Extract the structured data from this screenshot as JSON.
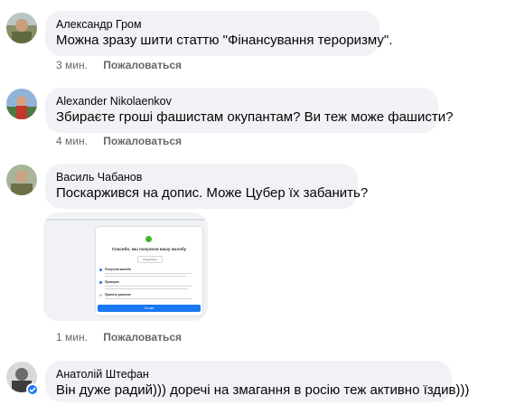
{
  "comments": [
    {
      "author": "Александр Гром",
      "text": "Можна зразу шити статтю \"Фінансування тероризму\".",
      "time": "3 мин.",
      "report": "Пожаловаться"
    },
    {
      "author": "Alexander Nikolaenkov",
      "text": "Збираєте гроші фашистам окупантам? Ви теж може фашисти?",
      "time": "4 мин.",
      "report": "Пожаловаться"
    },
    {
      "author": "Василь Чабанов",
      "text": "Поскаржився на допис. Може Цубер їх забанить?",
      "time": "1 мин.",
      "report": "Пожаловаться",
      "attachment": {
        "title": "Спасибо, мы получили вашу жалобу",
        "button": "Подробнее",
        "options": [
          "Получена жалоба",
          "Проверка",
          "Принято решение"
        ],
        "done": "Готово"
      }
    },
    {
      "author": "Анатолій Штефан",
      "text": "Він дуже радий))) доречі на змагання в росію теж активно їздив)))"
    }
  ],
  "colors": {
    "bubble": "#f0f2f5",
    "meta": "#65676b",
    "accent": "#1877f2"
  }
}
